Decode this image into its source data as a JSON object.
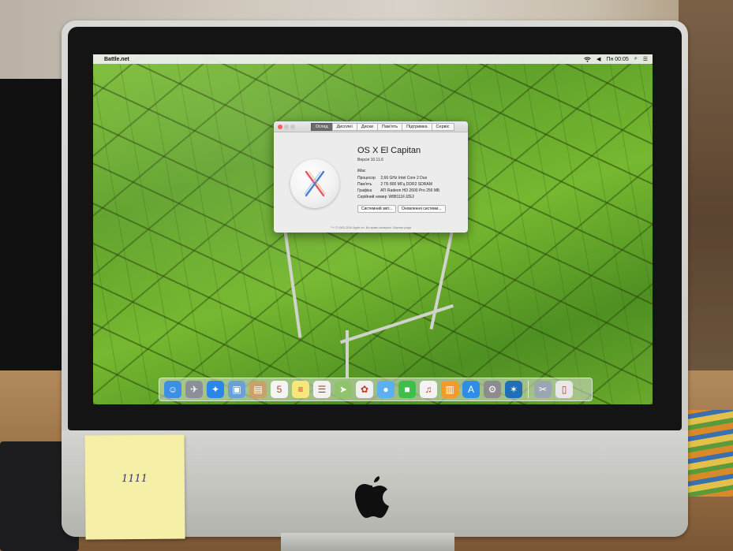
{
  "menubar": {
    "apple_symbol": "",
    "app_name": "Battle.net",
    "clock": "Пн 00:05",
    "icons": [
      "wifi-icon",
      "volume-icon",
      "spotlight-icon",
      "notification-center-icon"
    ]
  },
  "about_window": {
    "tabs": [
      {
        "label": "Огляд",
        "active": true
      },
      {
        "label": "Дисплеї",
        "active": false
      },
      {
        "label": "Диски",
        "active": false
      },
      {
        "label": "Пам'ять",
        "active": false
      },
      {
        "label": "Підтримка",
        "active": false
      },
      {
        "label": "Сервіс",
        "active": false
      }
    ],
    "os_name": "OS X El Capitan",
    "version": "Версія 10.11.6",
    "model": "iMac",
    "specs": [
      {
        "key": "Процесор",
        "value": "2,66 GHz Intel Core 2 Duo"
      },
      {
        "key": "Пам'ять",
        "value": "2 ГБ 800 МГц DDR2 SDRAM"
      },
      {
        "key": "Графіка",
        "value": "ATI Radeon HD 2600 Pro 256 МБ"
      },
      {
        "key": "Серійний номер",
        "value": "W88111FJZE2"
      }
    ],
    "buttons": {
      "system_report": "Системний звіт...",
      "software_update": "Оновлення системи..."
    },
    "copyright": "™ і © 1983–2016 Apple Inc. Всі права захищено. Ліцензія угода"
  },
  "dock": {
    "icons": [
      {
        "name": "finder-icon",
        "color": "#3d8fe6",
        "glyph": "☺"
      },
      {
        "name": "launchpad-icon",
        "color": "#8a8f99",
        "glyph": "✈"
      },
      {
        "name": "safari-icon",
        "color": "#2a86e8",
        "glyph": "✦"
      },
      {
        "name": "preview-icon",
        "color": "#6aa0d6",
        "glyph": "▣"
      },
      {
        "name": "contacts-icon",
        "color": "#c9a26a",
        "glyph": "▤"
      },
      {
        "name": "calendar-icon",
        "color": "#f4f4f4",
        "glyph": "5"
      },
      {
        "name": "notes-icon",
        "color": "#f7e77a",
        "glyph": "≡"
      },
      {
        "name": "reminders-icon",
        "color": "#f2f2f2",
        "glyph": "☰"
      },
      {
        "name": "maps-icon",
        "color": "#8fc46a",
        "glyph": "➤"
      },
      {
        "name": "photos-icon",
        "color": "#f0f0f0",
        "glyph": "✿"
      },
      {
        "name": "messages-icon",
        "color": "#5ab0f0",
        "glyph": "●"
      },
      {
        "name": "facetime-icon",
        "color": "#3fbf4a",
        "glyph": "■"
      },
      {
        "name": "itunes-icon",
        "color": "#f3f3f3",
        "glyph": "♫"
      },
      {
        "name": "ibooks-icon",
        "color": "#f39a2b",
        "glyph": "▥"
      },
      {
        "name": "app-store-icon",
        "color": "#2f8de6",
        "glyph": "A"
      },
      {
        "name": "system-preferences-icon",
        "color": "#8c8c8c",
        "glyph": "⚙"
      },
      {
        "name": "battlenet-icon",
        "color": "#1f6fb8",
        "glyph": "✶"
      }
    ],
    "trailing_icons": [
      {
        "name": "downloads-stack-icon",
        "color": "#9aa6b2",
        "glyph": "✂"
      },
      {
        "name": "trash-icon",
        "color": "#e8e8e8",
        "glyph": "▯"
      }
    ]
  },
  "sticky_note": {
    "text": "1111"
  }
}
